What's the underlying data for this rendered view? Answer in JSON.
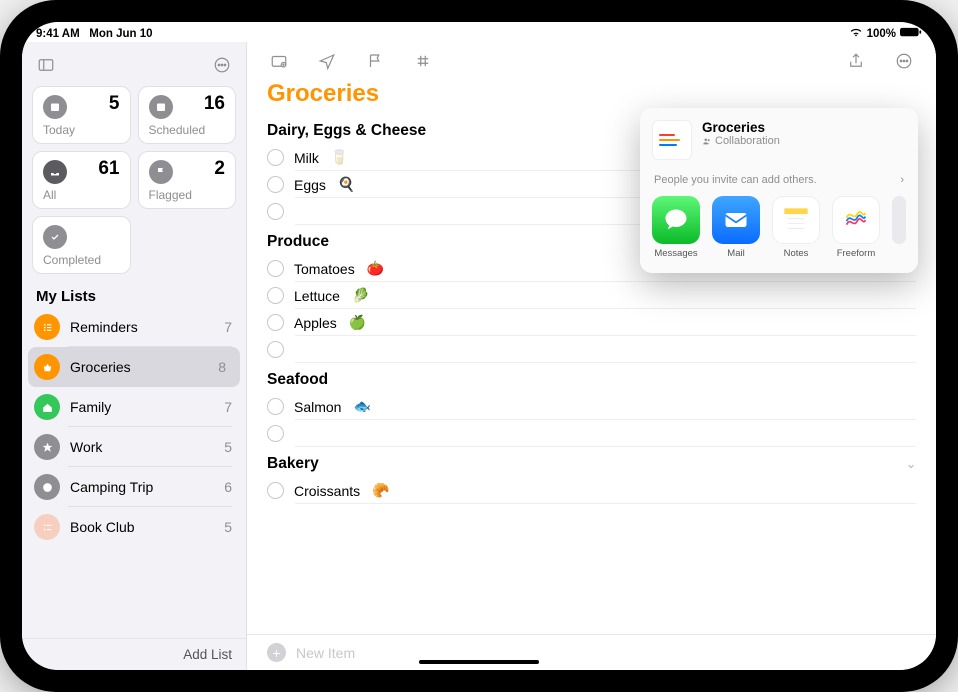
{
  "status": {
    "time": "9:41 AM",
    "date": "Mon Jun 10",
    "battery": "100%"
  },
  "sidebar": {
    "smart": [
      {
        "label": "Today",
        "count": "5"
      },
      {
        "label": "Scheduled",
        "count": "16"
      },
      {
        "label": "All",
        "count": "61"
      },
      {
        "label": "Flagged",
        "count": "2"
      },
      {
        "label": "Completed",
        "count": ""
      }
    ],
    "header": "My Lists",
    "lists": [
      {
        "name": "Reminders",
        "count": "7",
        "color": "#ff9500"
      },
      {
        "name": "Groceries",
        "count": "8",
        "color": "#ff9500"
      },
      {
        "name": "Family",
        "count": "7",
        "color": "#34c759"
      },
      {
        "name": "Work",
        "count": "5",
        "color": "#8e8e93"
      },
      {
        "name": "Camping Trip",
        "count": "6",
        "color": "#8e8e93"
      },
      {
        "name": "Book Club",
        "count": "5",
        "color": "#ffcfbf"
      }
    ],
    "addlist": "Add List"
  },
  "main": {
    "title": "Groceries",
    "sections": [
      {
        "name": "Dairy, Eggs & Cheese",
        "items": [
          {
            "text": "Milk",
            "emoji": "🥛"
          },
          {
            "text": "Eggs",
            "emoji": "🍳"
          },
          {
            "text": "",
            "emoji": ""
          }
        ]
      },
      {
        "name": "Produce",
        "items": [
          {
            "text": "Tomatoes",
            "emoji": "🍅"
          },
          {
            "text": "Lettuce",
            "emoji": "🥬"
          },
          {
            "text": "Apples",
            "emoji": "🍏"
          },
          {
            "text": "",
            "emoji": ""
          }
        ]
      },
      {
        "name": "Seafood",
        "items": [
          {
            "text": "Salmon",
            "emoji": "🐟"
          },
          {
            "text": "",
            "emoji": ""
          }
        ]
      },
      {
        "name": "Bakery",
        "chevron": true,
        "items": [
          {
            "text": "Croissants",
            "emoji": "🥐"
          }
        ]
      }
    ],
    "newitem": "New Item"
  },
  "share": {
    "title": "Groceries",
    "subtitle": "Collaboration",
    "note": "People you invite can add others.",
    "apps": [
      {
        "label": "Messages"
      },
      {
        "label": "Mail"
      },
      {
        "label": "Notes"
      },
      {
        "label": "Freeform"
      }
    ]
  }
}
